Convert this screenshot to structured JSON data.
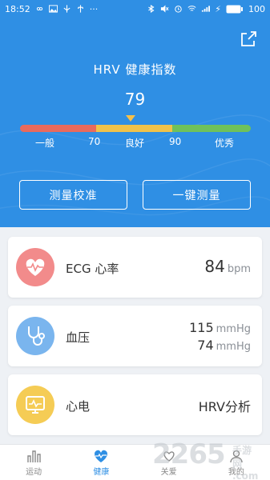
{
  "status_bar": {
    "time": "18:52",
    "battery": "100"
  },
  "hero": {
    "title": "HRV 健康指数",
    "value": "79",
    "ticks": [
      "一般",
      "70",
      "良好",
      "90",
      "优秀"
    ],
    "gauge_colors": [
      "#e86a5d",
      "#f0c24a",
      "#6fc15a"
    ],
    "pointer_color": "#f5c04a",
    "calibrate_button": "测量校准",
    "measure_button": "一键测量"
  },
  "cards": {
    "ecg": {
      "label": "ECG 心率",
      "value": "84",
      "unit": "bpm",
      "icon": "heart-icon",
      "color": "#f28b8b"
    },
    "bp": {
      "label": "血压",
      "systolic": "115",
      "diastolic": "74",
      "unit": "mmHg",
      "icon": "stethoscope-icon",
      "color": "#7ab5ee"
    },
    "ecg2": {
      "label": "心电",
      "value": "HRV分析",
      "icon": "ecg-monitor-icon",
      "color": "#f5cc55"
    }
  },
  "tabs": [
    {
      "label": "运动",
      "icon": "bar-chart-icon"
    },
    {
      "label": "健康",
      "icon": "heart-pulse-icon",
      "active": true
    },
    {
      "label": "关爱",
      "icon": "care-icon"
    },
    {
      "label": "我的",
      "icon": "person-icon"
    }
  ],
  "watermark": {
    "main": "2265",
    "sub1": "手游网",
    "sub2": ".com"
  },
  "accent": "#2f8fe4"
}
